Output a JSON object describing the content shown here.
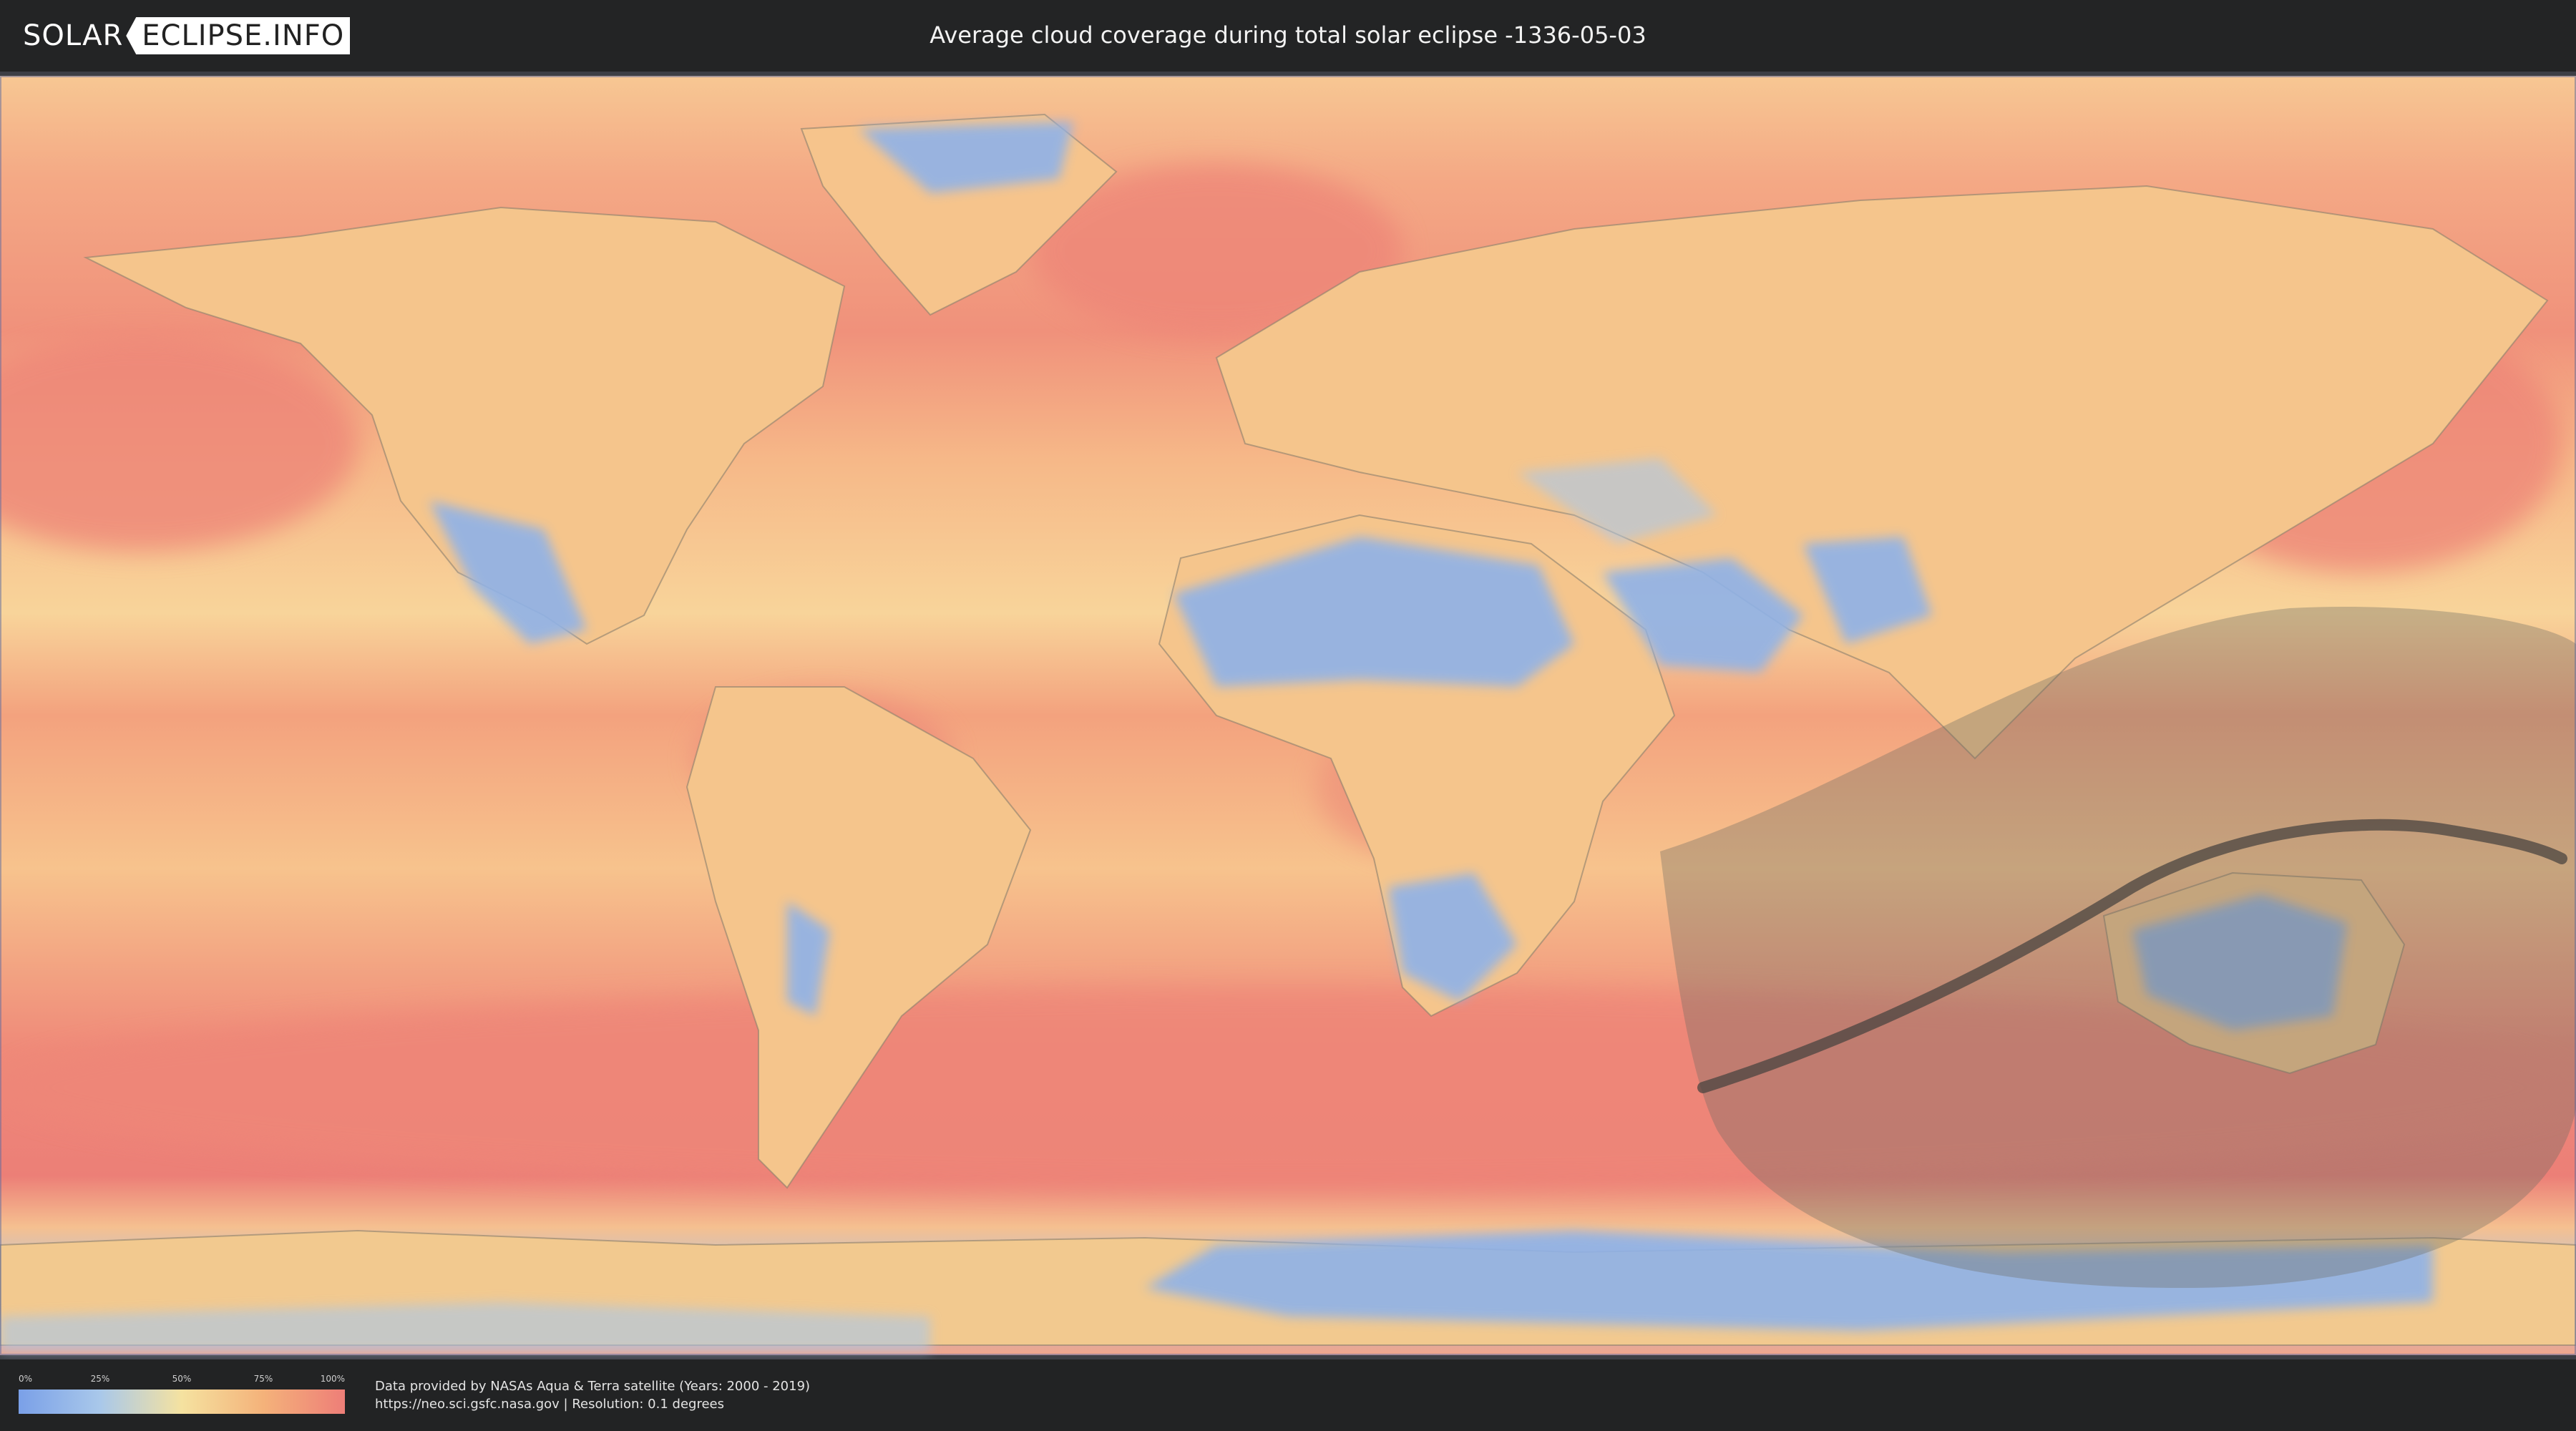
{
  "header": {
    "logo_part1": "SOLAR",
    "logo_part2": "ECLIPSE.INFO",
    "title": "Average cloud coverage during total solar eclipse -1336-05-03"
  },
  "map": {
    "background_colors": {
      "ocean_cloudy": "#ee8a78",
      "mid": "#f5c98e",
      "dry": "#8fb2e8",
      "path": "#4a4440",
      "penumbra": "#6b6a60"
    }
  },
  "legend": {
    "ticks": [
      "0%",
      "25%",
      "50%",
      "75%",
      "100%"
    ]
  },
  "footer": {
    "line1": "Data provided by NASAs Aqua & Terra satellite (Years: 2000 - 2019)",
    "line2": "https://neo.sci.gsfc.nasa.gov | Resolution: 0.1 degrees"
  }
}
